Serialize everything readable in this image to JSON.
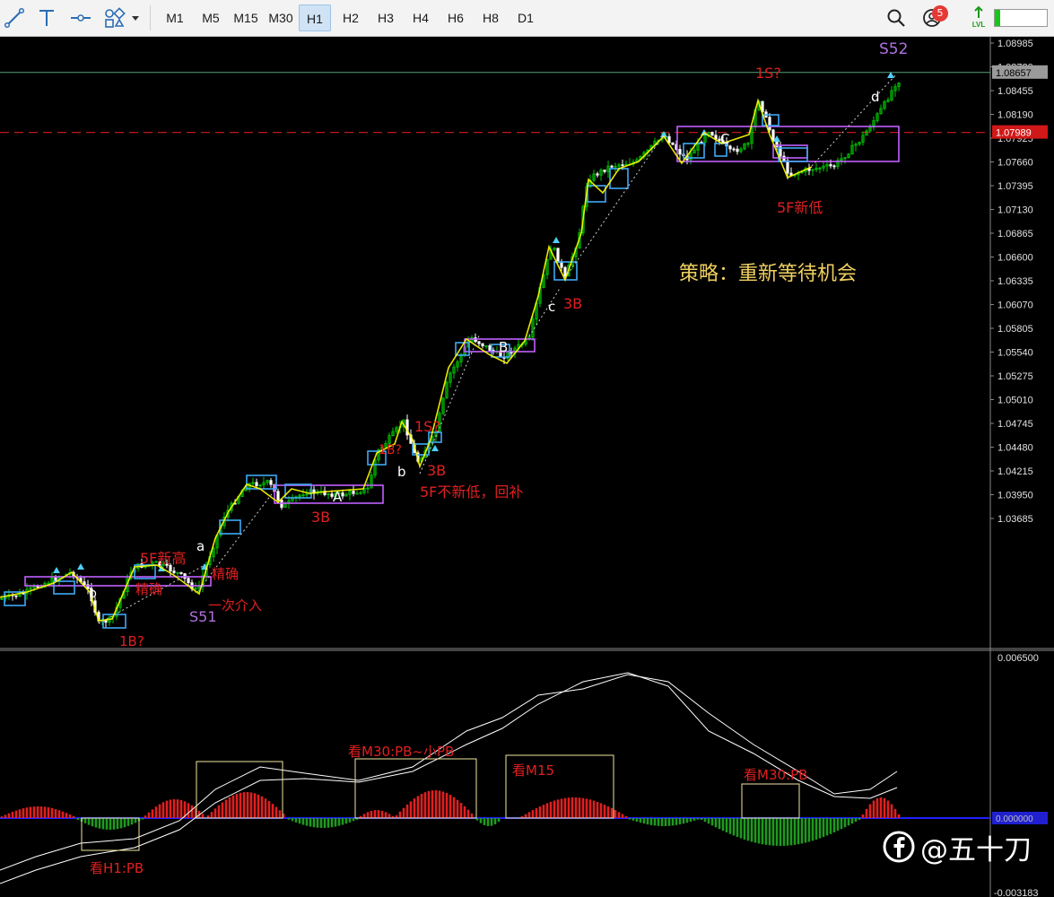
{
  "toolbar": {
    "drawing_tools": [
      "trendline-icon",
      "text-tool-icon",
      "hline-tool-icon",
      "shapes-icon"
    ],
    "timeframes": [
      "M1",
      "M5",
      "M15",
      "M30",
      "H1",
      "H2",
      "H3",
      "H4",
      "H6",
      "H8",
      "D1"
    ],
    "active_timeframe": "H1",
    "notification_count": "5",
    "lvl_label": "LVL"
  },
  "price_axis": {
    "ticks": [
      "1.08985",
      "1.08720",
      "1.08455",
      "1.08190",
      "1.07925",
      "1.07660",
      "1.07395",
      "1.07130",
      "1.06865",
      "1.06600",
      "1.06335",
      "1.06070",
      "1.05805",
      "1.05540",
      "1.05275",
      "1.05010",
      "1.04745",
      "1.04480",
      "1.04215",
      "1.03950",
      "1.03685"
    ],
    "current_price": "1.08657",
    "dashed_level": "1.07989"
  },
  "indicator_axis": {
    "top": "0.006500",
    "bottom": "-0.003183",
    "zero": "0.000000"
  },
  "annotations": {
    "strategy_text": "策略：重新等待机会",
    "s52": "S52",
    "s51": "S51",
    "one_s_top": "1S?",
    "one_s_mid": "1S?",
    "one_b": "1B?",
    "three_b_1": "3B",
    "three_b_2": "3B",
    "three_b_3": "3B",
    "five_f_new_low": "5F新低",
    "five_f_no_new_low": "5F不新低，回补",
    "five_f_new_high": "5F新高",
    "confirm_1": "精确",
    "confirm_2": "精确",
    "first_entry": "一次介入",
    "one_b_mid": "1B?",
    "wave_a": "a",
    "wave_b": "b",
    "wave_c": "c",
    "wave_d": "d",
    "box_A": "A",
    "box_B": "B",
    "box_C": "C",
    "box_b_small": "b"
  },
  "indicator_annotations": {
    "h1_pb": "看H1:PB",
    "m30_pb_small": "看M30:PB~小PB",
    "m15": "看M15",
    "m30_pb": "看M30:PB"
  },
  "watermark": {
    "text": "@五十刀",
    "logo": "facebook-logo"
  },
  "colors": {
    "bull": "#00c800",
    "bear": "#ffffff",
    "zigzag": "#ffff00",
    "pivot_box": "#c060ff",
    "center_box": "#3fa9f5",
    "label_red": "#e02020",
    "label_violet": "#b070e0",
    "macd_up": "#e02020",
    "macd_down": "#1f9a1f",
    "zero_line": "#2020ff",
    "price_line": "#5aa07a",
    "dashed_line": "#c01818",
    "strategy_text": "#f0d060"
  }
}
